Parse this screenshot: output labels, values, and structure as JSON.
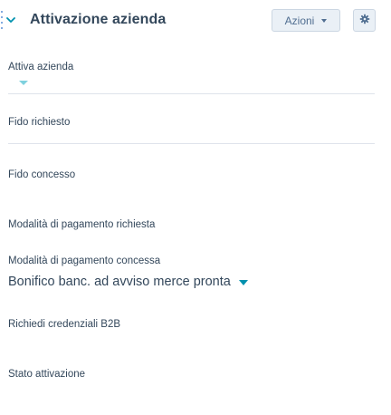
{
  "card": {
    "title": "Attivazione azienda",
    "actions_label": "Azioni",
    "icons": {
      "collapse": "chevron-down-icon",
      "actions_caret": "caret-down-icon",
      "settings": "gear-icon",
      "drag": "drag-handle-icon"
    }
  },
  "fields": {
    "attiva_azienda": {
      "label": "Attiva azienda",
      "value": ""
    },
    "fido_richiesto": {
      "label": "Fido richiesto",
      "value": ""
    },
    "fido_concesso": {
      "label": "Fido concesso",
      "value": ""
    },
    "modalita_pagamento_richiesta": {
      "label": "Modalità di pagamento richiesta",
      "value": ""
    },
    "modalita_pagamento_concessa": {
      "label": "Modalità di pagamento concessa",
      "value": "Bonifico banc. ad avviso merce pronta"
    },
    "richiedi_credenziali_b2b": {
      "label": "Richiedi credenziali B2B",
      "value": ""
    },
    "stato_attivazione": {
      "label": "Stato attivazione",
      "value": ""
    }
  },
  "colors": {
    "accent": "#0091ae",
    "accent_light": "#7fd1de",
    "text": "#33475b",
    "button_bg": "#eaf0f6",
    "button_border": "#cbd6e2",
    "divider": "#dfe3eb"
  }
}
